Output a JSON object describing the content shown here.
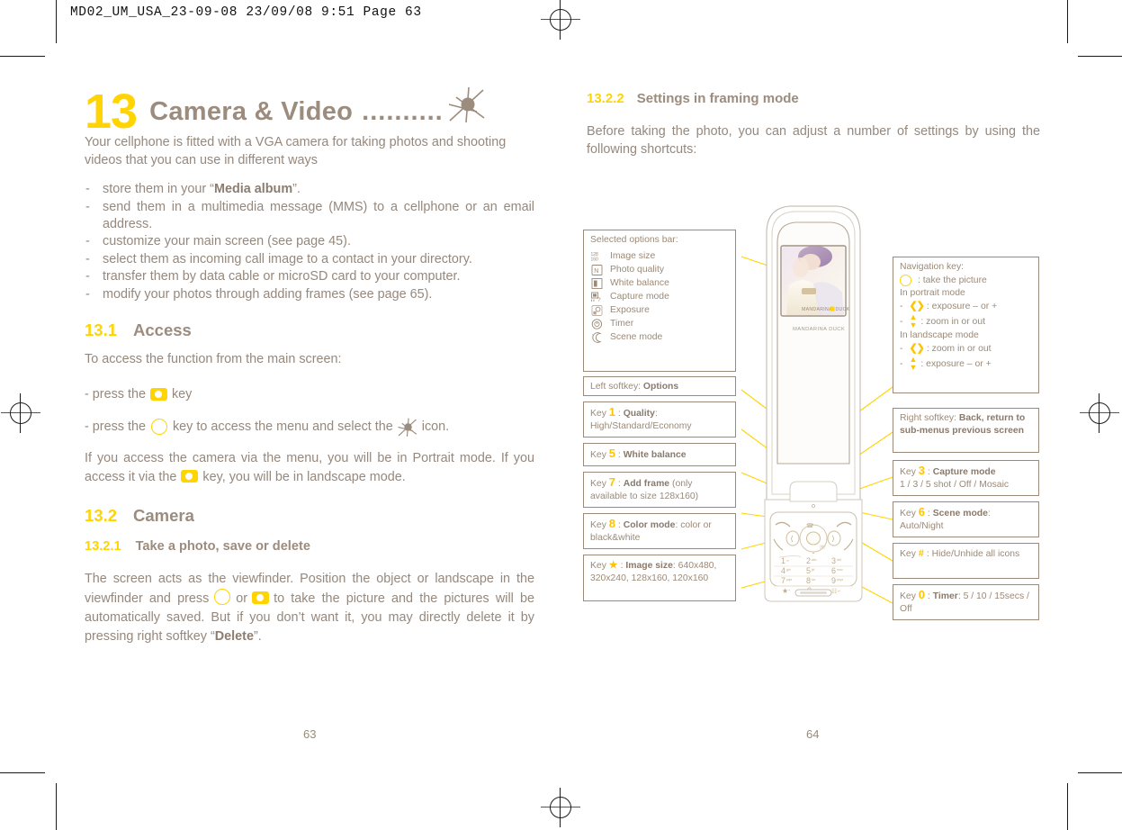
{
  "print": {
    "job_line": "MD02_UM_USA_23-09-08  23/09/08  9:51  Page 63"
  },
  "left_page": {
    "chapter_number": "13",
    "chapter_title": "Camera & Video",
    "chapter_dots": "..........",
    "intro": "Your cellphone is fitted with a VGA camera for taking photos and shooting videos that you can use in different ways",
    "bullets": [
      {
        "dash": "-",
        "text": "store them in your “",
        "bold": "Media album",
        "tail": "”."
      },
      {
        "dash": "-",
        "text": "send them in a multimedia message (MMS) to a cellphone or an email address.",
        "bold": "",
        "tail": ""
      },
      {
        "dash": "-",
        "text": "customize your main screen (see page 45).",
        "bold": "",
        "tail": ""
      },
      {
        "dash": "-",
        "text": "select them as incoming call image to a contact in your directory.",
        "bold": "",
        "tail": ""
      },
      {
        "dash": "-",
        "text": "transfer them by data cable or microSD card to your computer.",
        "bold": "",
        "tail": ""
      },
      {
        "dash": "-",
        "text": "modify your photos through adding frames (see page 65).",
        "bold": "",
        "tail": ""
      }
    ],
    "section_13_1": {
      "number": "13.1",
      "title": "Access"
    },
    "access_intro": "To access the function from the main screen:",
    "access_step1_a": "- press the",
    "access_step1_b": "key",
    "access_step2_a": "- press the",
    "access_step2_b": "key to access the menu and select the",
    "access_step2_c": "icon.",
    "access_note_a": "If you access the camera via the menu, you will be in Portrait mode. If you access it via the",
    "access_note_b": "key, you will be in landscape mode.",
    "section_13_2": {
      "number": "13.2",
      "title": "Camera"
    },
    "section_13_2_1": {
      "number": "13.2.1",
      "title": "Take a photo, save or delete"
    },
    "camera_para_a": "The screen acts as the viewfinder. Position the object or landscape in the viewfinder and press",
    "camera_para_or": "or",
    "camera_para_b": "to take the picture and the pictures will be automatically saved. But if you don’t want it, you may directly delete it by pressing right softkey “",
    "camera_para_bold": "Delete",
    "camera_para_c": "”.",
    "page_number": "63"
  },
  "right_page": {
    "section_13_2_2": {
      "number": "13.2.2",
      "title": "Settings in framing mode"
    },
    "intro": "Before taking the photo, you can adjust a number of settings by using the following shortcuts:",
    "page_number": "64"
  },
  "figure": {
    "options_bar": {
      "title": "Selected options bar:",
      "items": [
        {
          "icon": "image-size-icon",
          "label": "Image size"
        },
        {
          "icon": "photo-quality-icon",
          "label": "Photo quality"
        },
        {
          "icon": "white-balance-icon",
          "label": "White balance"
        },
        {
          "icon": "capture-mode-icon",
          "label": "Capture mode"
        },
        {
          "icon": "exposure-icon",
          "label": "Exposure"
        },
        {
          "icon": "timer-icon",
          "label": "Timer"
        },
        {
          "icon": "scene-mode-icon",
          "label": "Scene mode"
        }
      ]
    },
    "left_callouts": [
      {
        "name": "left-softkey",
        "prefix": "Left softkey:",
        "bold": "Options",
        "suffix": ""
      },
      {
        "name": "key-1-quality",
        "keyword": "Key",
        "key": "1",
        "bold": "Quality",
        "suffix": ": High/Standard/Economy"
      },
      {
        "name": "key-5-white-balance",
        "keyword": "Key",
        "key": "5",
        "bold": "White balance",
        "suffix": ""
      },
      {
        "name": "key-7-add-frame",
        "keyword": "Key",
        "key": "7",
        "bold": "Add frame",
        "suffix": " (only available to size 128x160)"
      },
      {
        "name": "key-8-color-mode",
        "keyword": "Key",
        "key": "8",
        "bold": "Color mode",
        "suffix": ": color or black&white"
      },
      {
        "name": "key-star-image-size",
        "keyword": "Key",
        "key": "★",
        "bold": "Image size",
        "suffix": ": 640x480, 320x240, 128x160, 120x160"
      }
    ],
    "navigation_key": {
      "title": "Navigation key:",
      "take_picture": ": take the picture",
      "portrait_label": "In portrait mode",
      "portrait_items": [
        {
          "glyph": "❮❯",
          "text": ": exposure – or +"
        },
        {
          "glyph": "⌃⌄",
          "text": ": zoom in or out"
        }
      ],
      "landscape_label": "In landscape mode",
      "landscape_items": [
        {
          "glyph": "❮❯",
          "text": ": zoom in or out"
        },
        {
          "glyph": "⌃⌄",
          "text": ": exposure – or +"
        }
      ]
    },
    "right_callouts": [
      {
        "name": "right-softkey",
        "prefix": "Right softkey:",
        "bold": "Back, return to sub-menus previous screen",
        "suffix": ""
      },
      {
        "name": "key-3-capture-mode",
        "keyword": "Key",
        "key": "3",
        "bold": "Capture mode",
        "suffix": "1 / 3 / 5 shot / Off / Mosaic"
      },
      {
        "name": "key-6-scene-mode",
        "keyword": "Key",
        "key": "6",
        "bold": "Scene mode",
        "suffix": ": Auto/Night"
      },
      {
        "name": "key-hash-hide-icons",
        "keyword": "Key",
        "key": "#",
        "bold": "",
        "suffix": ": Hide/Unhide all icons"
      },
      {
        "name": "key-0-timer",
        "keyword": "Key",
        "key": "0",
        "bold": "Timer",
        "suffix": ": 5 / 10 / 15secs / Off"
      }
    ],
    "phone": {
      "brand": "MANDARINA DUCK",
      "screen_brand": "MANDARINA DUCK",
      "keys": [
        {
          "label": "1",
          "sub": "∞"
        },
        {
          "label": "2",
          "sub": "abc"
        },
        {
          "label": "3",
          "sub": "def"
        },
        {
          "label": "4",
          "sub": "ghi"
        },
        {
          "label": "5",
          "sub": "jkl"
        },
        {
          "label": "6",
          "sub": "mno"
        },
        {
          "label": "7",
          "sub": "pqrs"
        },
        {
          "label": "8",
          "sub": "tuv"
        },
        {
          "label": "9",
          "sub": "wxyz"
        },
        {
          "label": "★",
          "sub": "+"
        },
        {
          "label": "0",
          "sub": "+"
        },
        {
          "label": "#",
          "sub": "↵"
        }
      ]
    }
  },
  "colors": {
    "yellow": "#FFD400",
    "brown": "#9b8a78",
    "body": "#96887c"
  }
}
